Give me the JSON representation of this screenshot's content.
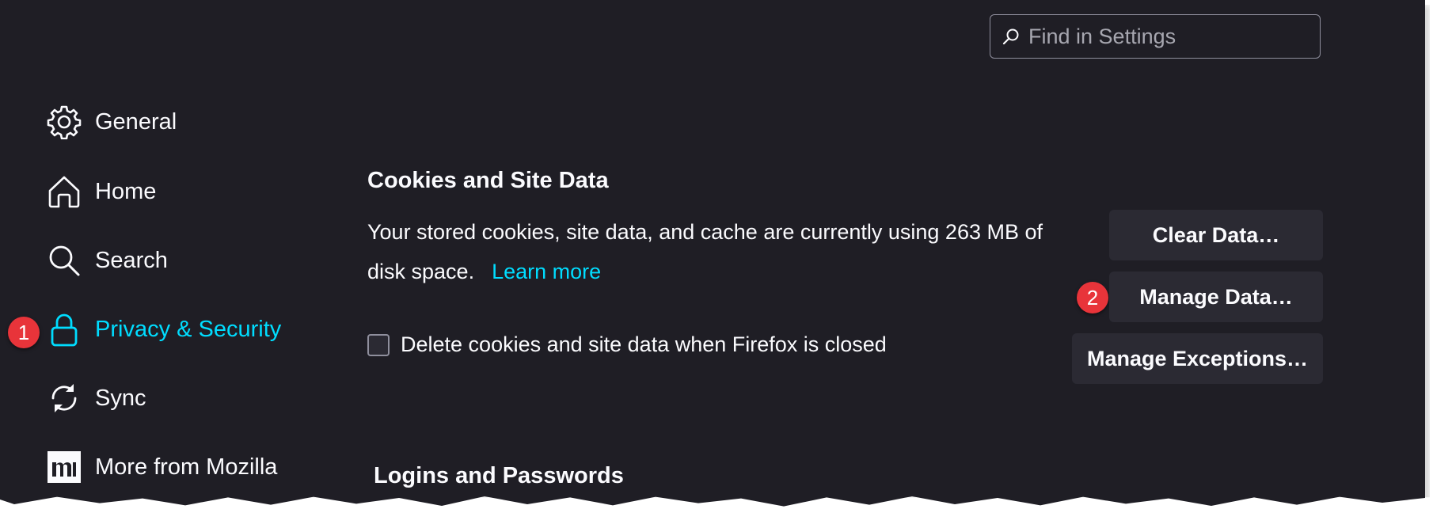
{
  "search": {
    "placeholder": "Find in Settings"
  },
  "sidebar": {
    "items": [
      {
        "label": "General",
        "icon": "gear-icon"
      },
      {
        "label": "Home",
        "icon": "home-icon"
      },
      {
        "label": "Search",
        "icon": "search-icon"
      },
      {
        "label": "Privacy & Security",
        "icon": "lock-icon",
        "active": true
      },
      {
        "label": "Sync",
        "icon": "sync-icon"
      },
      {
        "label": "More from Mozilla",
        "icon": "mozilla-icon"
      }
    ]
  },
  "callouts": {
    "one": "1",
    "two": "2"
  },
  "cookies": {
    "title": "Cookies and Site Data",
    "description": "Your stored cookies, site data, and cache are currently using 263 MB of disk space.",
    "learn_more": "Learn more",
    "clear_button": "Clear Data…",
    "manage_button": "Manage Data…",
    "exceptions_button": "Manage Exceptions…",
    "delete_checkbox_label": "Delete cookies and site data when Firefox is closed",
    "delete_checkbox_checked": false
  },
  "logins": {
    "title": "Logins and Passwords"
  },
  "colors": {
    "background": "#1f1e25",
    "accent": "#00ddff",
    "button": "#2b2a33",
    "callout": "#e8343a",
    "text": "#fbfbfe"
  }
}
